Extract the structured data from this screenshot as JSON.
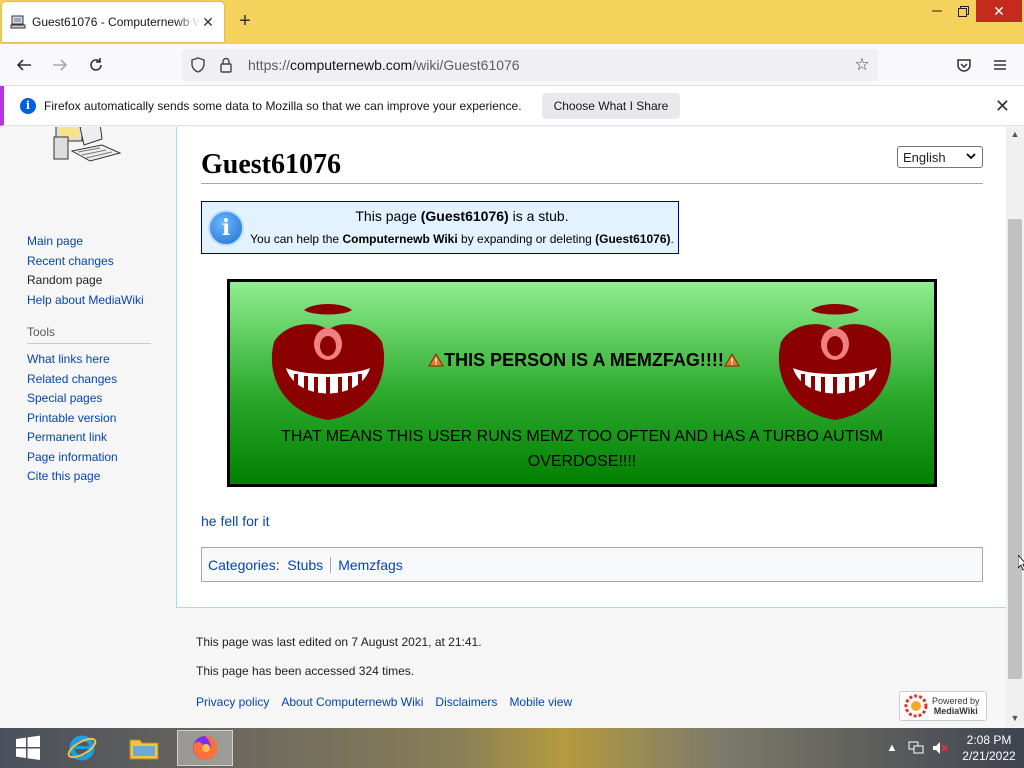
{
  "browser": {
    "tab_title": "Guest61076 - Computernewb Wiki",
    "new_tab_symbol": "+",
    "url_scheme": "https://",
    "url_host": "computernewb.com",
    "url_path": "/wiki/Guest61076",
    "notification_text": "Firefox automatically sends some data to Mozilla so that we can improve your experience.",
    "notification_button": "Choose What I Share"
  },
  "sidebar": {
    "navigation": [
      "Main page",
      "Recent changes",
      "Random page",
      "Help about MediaWiki"
    ],
    "tools_heading": "Tools",
    "tools": [
      "What links here",
      "Related changes",
      "Special pages",
      "Printable version",
      "Permanent link",
      "Page information",
      "Cite this page"
    ]
  },
  "article": {
    "title": "Guest61076",
    "language": "English",
    "stub_line1_pre": "This page ",
    "stub_line1_bold": "(Guest61076)",
    "stub_line1_post": " is a stub.",
    "stub_line2_pre": "You can help the ",
    "stub_line2_bold1": "Computernewb Wiki",
    "stub_line2_mid": " by expanding or deleting ",
    "stub_line2_bold2": "(Guest61076)",
    "stub_line2_post": ".",
    "memz_headline": "THIS PERSON IS A MEMZFAG!!!!",
    "memz_subtext": "THAT MEANS THIS USER RUNS MEMZ TOO OFTEN AND HAS A TURBO AUTISM OVERDOSE!!!!",
    "body_link": "he fell for it",
    "categories_label": "Categories",
    "categories": [
      "Stubs",
      "Memzfags"
    ]
  },
  "footer": {
    "last_edited": "This page was last edited on 7 August 2021, at 21:41.",
    "accessed": "This page has been accessed 324 times.",
    "links": [
      "Privacy policy",
      "About Computernewb Wiki",
      "Disclaimers",
      "Mobile view"
    ],
    "powered_by_line1": "Powered by",
    "powered_by_line2": "MediaWiki"
  },
  "taskbar": {
    "time": "2:08 PM",
    "date": "2/21/2022"
  },
  "colors": {
    "titlebar": "#f5d25b",
    "link": "#0645ad",
    "stub_bg": "#e2f2ff",
    "memz_green": "#2eaa2e",
    "memz_red": "#8b0000"
  }
}
